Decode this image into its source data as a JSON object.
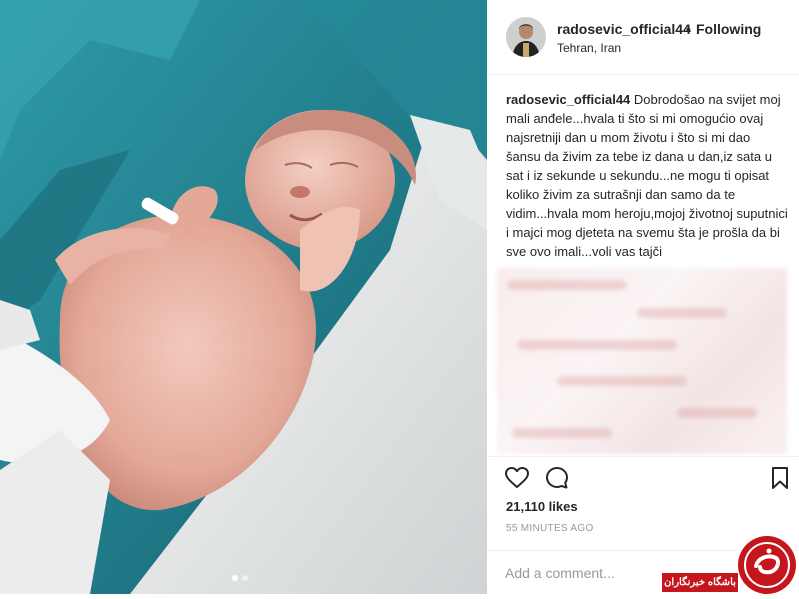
{
  "post": {
    "username": "radosevic_official44",
    "separator": "•",
    "follow_status": "Following",
    "location": "Tehran, Iran",
    "caption_username": "radosevic_official44",
    "caption_text": " Dobrodošao na svijet moj mali anđele...hvala ti što si mi omogućio ovaj najsretniji dan u mom životu i što si mi dao šansu da živim za tebe iz dana u dan,iz sata u sat i iz sekunde u sekundu...ne mogu ti opisat koliko živim za sutrašnji dan samo da te vidim...hvala mom heroju,mojoj životnoj suputnici i majci mog djeteta na svemu šta je prošla da bi sve ovo imali...voli vas tajči",
    "likes": "21,110 likes",
    "time_ago": "55 MINUTES AGO"
  },
  "carousel": {
    "total": 2,
    "active": 1
  },
  "comment": {
    "placeholder": "Add a comment..."
  },
  "icons": {
    "like": "heart-icon",
    "comment": "speech-bubble-icon",
    "save": "bookmark-icon",
    "watermark": "news-logo-icon"
  },
  "watermark": {
    "text": "باشگاه خبرنگاران"
  },
  "colors": {
    "text": "#262626",
    "muted": "#999999",
    "border": "#efefef",
    "watermark_red": "#c4161c"
  }
}
